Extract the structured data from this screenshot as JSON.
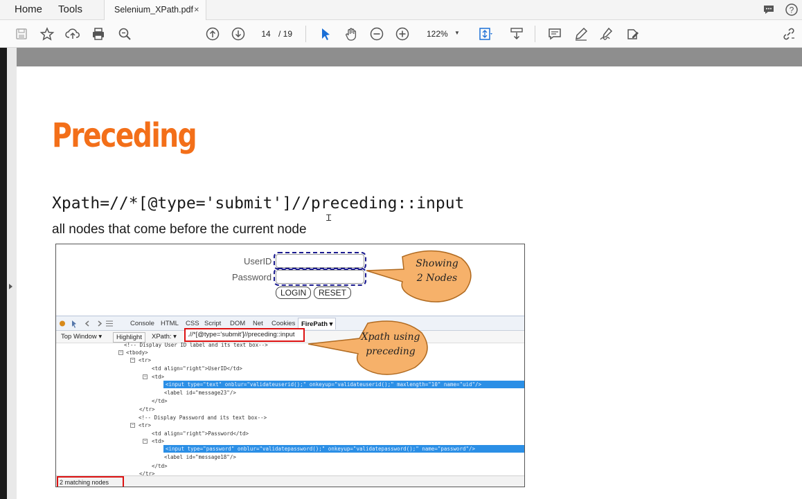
{
  "menubar": {
    "home_label": "Home",
    "tools_label": "Tools",
    "document_tab": "Selenium_XPath.pdf",
    "tab_close_glyph": "×",
    "right_icons": [
      "comment-icon",
      "help-icon"
    ]
  },
  "toolbar": {
    "current_page": "14",
    "page_total": "/ 19",
    "zoom": "122%",
    "icons": [
      "save-icon",
      "bookmark-star-icon",
      "upload-cloud-icon",
      "print-icon",
      "search-zoom-icon",
      "previous-page-icon",
      "next-page-icon",
      "select-cursor-icon",
      "hand-tool-icon",
      "zoom-out-icon",
      "zoom-in-icon",
      "fit-page-icon",
      "scroll-mode-icon",
      "comment-icon",
      "highlight-pen-icon",
      "sign-icon",
      "edit-icon",
      "share-link-icon"
    ]
  },
  "slide": {
    "title": "Preceding",
    "xpath": "Xpath=//*[@type='submit']//preceding::input",
    "description": "all nodes that come before the current node"
  },
  "screenshot": {
    "userid_label": "UserID",
    "password_label": "Password",
    "login_button": "LOGIN",
    "reset_button": "RESET",
    "callout_nodes": [
      "Showing",
      "2 Nodes"
    ],
    "callout_xpath": [
      "Xpath using",
      "preceding"
    ],
    "firebug_tabs": [
      "Console",
      "HTML",
      "CSS",
      "Script",
      "DOM",
      "Net",
      "Cookies",
      "FirePath ▾"
    ],
    "top_window_btn": "Top Window",
    "highlight_btn": "Highlight",
    "xpath_btn": "XPath:",
    "xpath_value": ".//*[@type='submit']//preceding::input",
    "status": "2 matching nodes",
    "code_lines": [
      "<!-- Display User ID label and its text box-->",
      "<tbody>",
      "<tr>",
      "<td align=\"right\">UserID</td>",
      "<td>",
      "<input type=\"text\" onblur=\"validateuserid();\" onkeyup=\"validateuserid();\" maxlength=\"10\" name=\"uid\"/>",
      "<label id=\"message23\"/>",
      "</td>",
      "</tr>",
      "<!-- Display Password and its text box-->",
      "<tr>",
      "<td align=\"right\">Password</td>",
      "<td>",
      "<input type=\"password\" onblur=\"validatepassword();\" onkeyup=\"validatepassword();\" name=\"password\"/>",
      "<label id=\"message18\"/>",
      "</td>",
      "</tr>"
    ]
  },
  "colors": {
    "title_orange": "#f36f19",
    "callout_fill": "#f6b16a",
    "selection_blue": "#2b8fe6",
    "red_box": "#dd1111"
  }
}
